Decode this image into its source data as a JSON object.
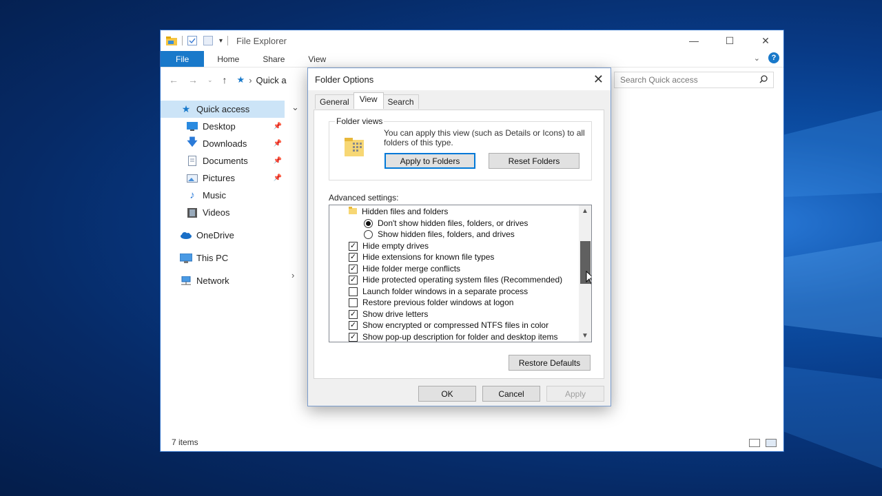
{
  "explorer": {
    "title": "File Explorer",
    "ribbon_tabs": [
      "File",
      "Home",
      "Share",
      "View"
    ],
    "address": "Quick a",
    "search_placeholder": "Search Quick access",
    "nav": [
      {
        "label": "Quick access",
        "icon": "star-icon"
      },
      {
        "label": "Desktop",
        "icon": "desktop-icon",
        "pinned": true
      },
      {
        "label": "Downloads",
        "icon": "download-icon",
        "pinned": true
      },
      {
        "label": "Documents",
        "icon": "documents-icon",
        "pinned": true
      },
      {
        "label": "Pictures",
        "icon": "pictures-icon",
        "pinned": true
      },
      {
        "label": "Music",
        "icon": "music-icon"
      },
      {
        "label": "Videos",
        "icon": "videos-icon"
      },
      {
        "label": "OneDrive",
        "icon": "onedrive-icon"
      },
      {
        "label": "This PC",
        "icon": "computer-icon"
      },
      {
        "label": "Network",
        "icon": "network-icon"
      }
    ],
    "status": "7 items"
  },
  "dialog": {
    "title": "Folder Options",
    "tabs": [
      "General",
      "View",
      "Search"
    ],
    "active_tab": "View",
    "folder_views": {
      "legend": "Folder views",
      "description": "You can apply this view (such as Details or Icons) to all folders of this type.",
      "apply_button": "Apply to Folders",
      "reset_button": "Reset Folders"
    },
    "advanced_label": "Advanced settings:",
    "settings": [
      {
        "type": "folder",
        "label": "Hidden files and folders"
      },
      {
        "type": "radio",
        "label": "Don't show hidden files, folders, or drives",
        "checked": true
      },
      {
        "type": "radio",
        "label": "Show hidden files, folders, and drives",
        "checked": false
      },
      {
        "type": "check",
        "label": "Hide empty drives",
        "checked": true
      },
      {
        "type": "check",
        "label": "Hide extensions for known file types",
        "checked": true
      },
      {
        "type": "check",
        "label": "Hide folder merge conflicts",
        "checked": true
      },
      {
        "type": "check",
        "label": "Hide protected operating system files (Recommended)",
        "checked": true
      },
      {
        "type": "check",
        "label": "Launch folder windows in a separate process",
        "checked": false
      },
      {
        "type": "check",
        "label": "Restore previous folder windows at logon",
        "checked": false
      },
      {
        "type": "check",
        "label": "Show drive letters",
        "checked": true
      },
      {
        "type": "check",
        "label": "Show encrypted or compressed NTFS files in color",
        "checked": true
      },
      {
        "type": "check",
        "label": "Show pop-up description for folder and desktop items",
        "checked": true
      }
    ],
    "restore_defaults": "Restore Defaults",
    "ok": "OK",
    "cancel": "Cancel",
    "apply": "Apply"
  }
}
